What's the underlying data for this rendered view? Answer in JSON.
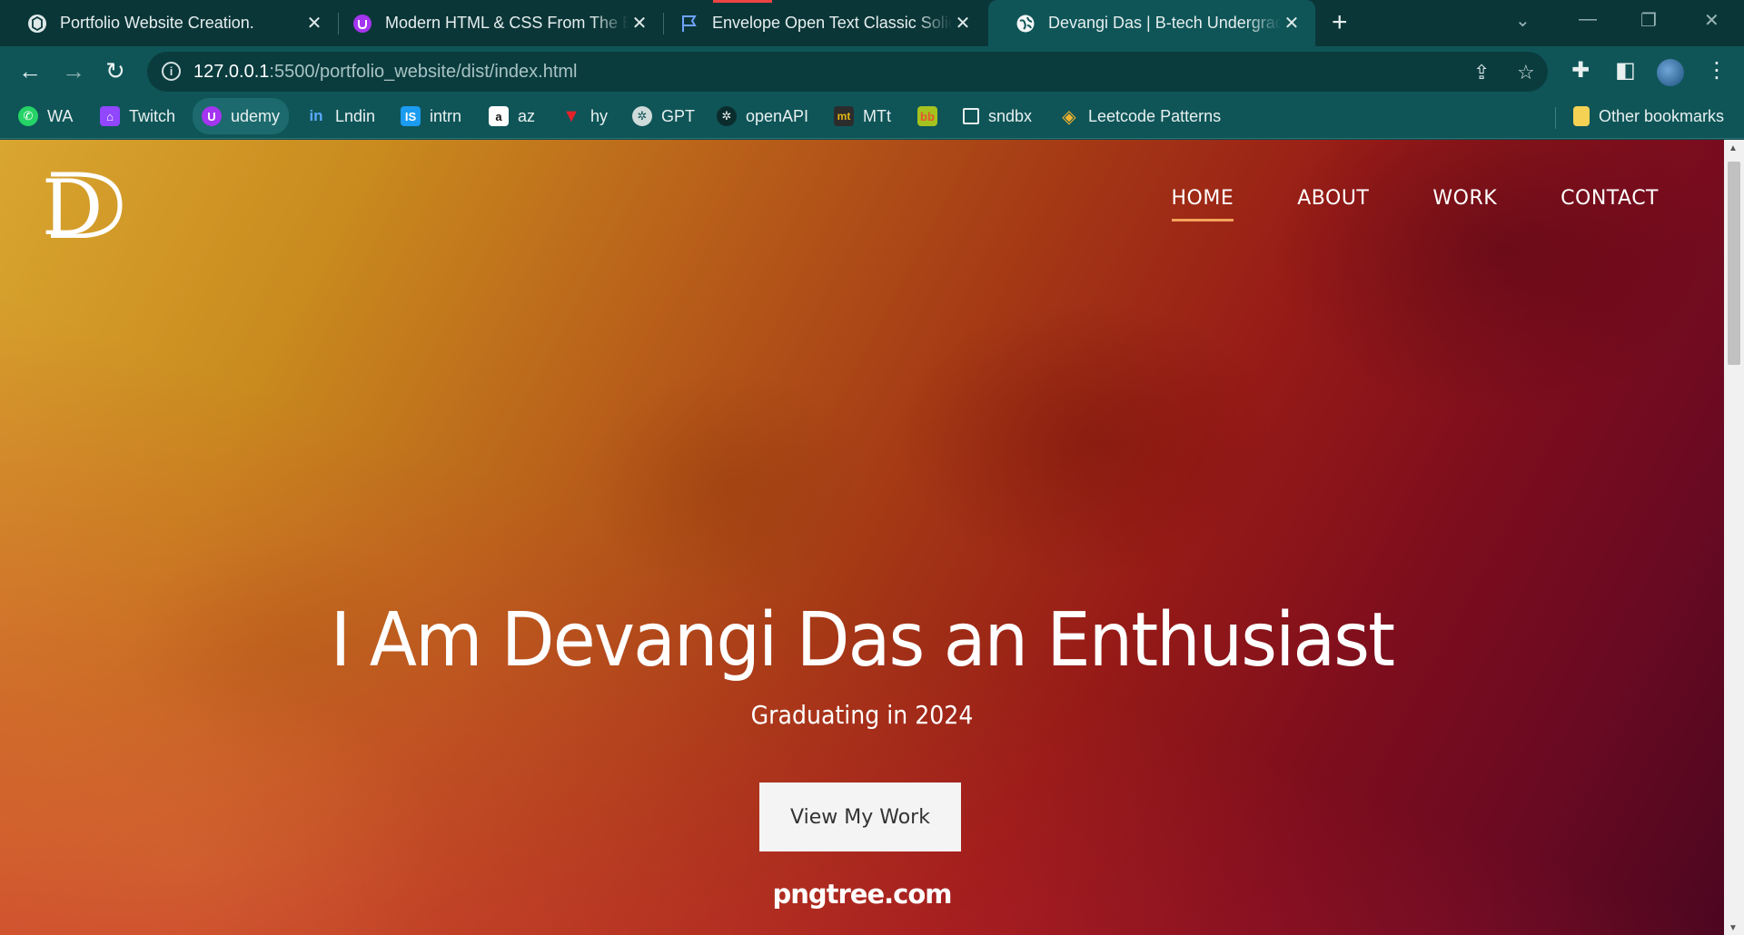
{
  "browser": {
    "tabs": [
      {
        "title": "Portfolio Website Creation.",
        "icon": "chatgpt-icon",
        "active": false
      },
      {
        "title": "Modern HTML & CSS From The B",
        "icon": "udemy-icon",
        "active": false
      },
      {
        "title": "Envelope Open Text Classic Solid",
        "icon": "flag-icon",
        "active": false
      },
      {
        "title": "Devangi Das | B-tech Undergraduate",
        "icon": "globe-icon",
        "active": true
      }
    ],
    "address": {
      "host": "127.0.0.1",
      "path": ":5500/portfolio_website/dist/index.html"
    },
    "bookmarks": [
      {
        "label": "WA",
        "icon": "whatsapp-icon"
      },
      {
        "label": "Twitch",
        "icon": "twitch-icon"
      },
      {
        "label": "udemy",
        "icon": "udemy-icon"
      },
      {
        "label": "Lndin",
        "icon": "linkedin-icon"
      },
      {
        "label": "intrn",
        "icon": "internshala-icon"
      },
      {
        "label": "az",
        "icon": "amazon-icon"
      },
      {
        "label": "hy",
        "icon": "hackerrank-icon"
      },
      {
        "label": "GPT",
        "icon": "chatgpt-icon"
      },
      {
        "label": "openAPI",
        "icon": "openai-icon"
      },
      {
        "label": "MTt",
        "icon": "monkeytype-icon"
      },
      {
        "label": "",
        "icon": "bb-icon"
      },
      {
        "label": "sndbx",
        "icon": "sandbox-icon"
      },
      {
        "label": "Leetcode Patterns",
        "icon": "leetcode-patterns-icon"
      }
    ],
    "other_bookmarks": "Other bookmarks"
  },
  "page": {
    "logo_letter": "D",
    "nav": [
      {
        "label": "HOME",
        "active": true
      },
      {
        "label": "ABOUT",
        "active": false
      },
      {
        "label": "WORK",
        "active": false
      },
      {
        "label": "CONTACT",
        "active": false
      }
    ],
    "hero_title": "I Am Devangi Das an Enthusiast",
    "hero_subtitle": "Graduating in 2024",
    "cta_label": "View My Work",
    "watermark": "pngtree.com"
  },
  "colors": {
    "chrome_dark": "#0b3638",
    "chrome": "#0f5558",
    "nav_active_underline": "#f3a35a"
  }
}
